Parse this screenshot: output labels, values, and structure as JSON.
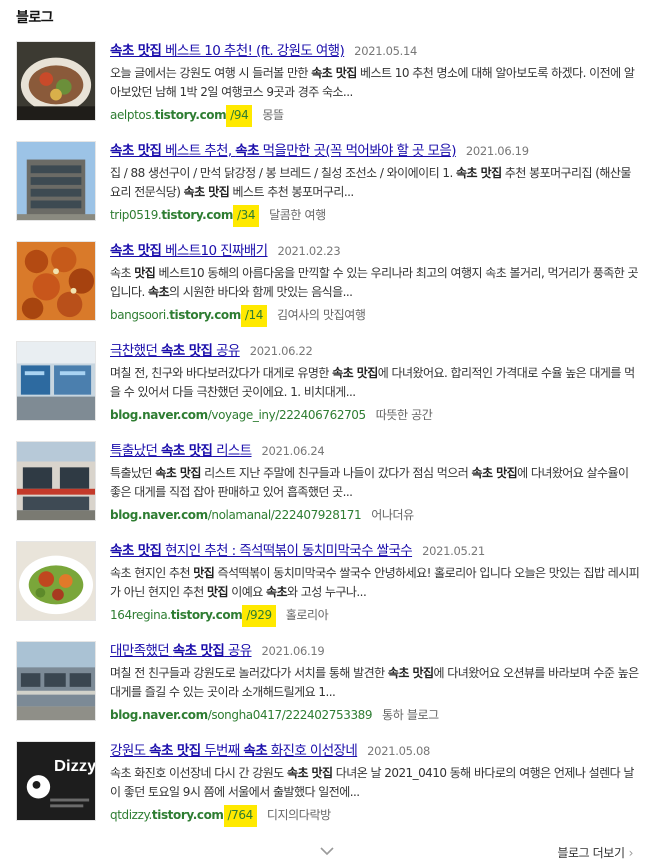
{
  "section": {
    "title": "블로그"
  },
  "results": [
    {
      "title_parts": [
        [
          "b",
          "속초 맛집"
        ],
        [
          "t",
          " 베스트 10 추천! (ft. 강원도 여행)"
        ]
      ],
      "date": "2021.05.14",
      "snippet_parts": [
        [
          "t",
          "오늘 글에서는 강원도 여행 시 들러볼 만한 "
        ],
        [
          "b",
          "속초 맛집"
        ],
        [
          "t",
          " 베스트 10 추천 명소에 대해 알아보도록 하겠다. 이전에 알아보았던 남해 1박 2일 여행코스 9곳과 경주 숙소..."
        ]
      ],
      "url_parts": [
        [
          "t",
          "aelptos."
        ],
        [
          "b",
          "tistory.com"
        ],
        [
          "h",
          "/94"
        ]
      ],
      "author": "몽뜰",
      "thumb": "food-bowl"
    },
    {
      "title_parts": [
        [
          "b",
          "속초 맛집"
        ],
        [
          "t",
          " 베스트 추천, "
        ],
        [
          "b",
          "속초"
        ],
        [
          "t",
          " 먹을만한 곳(꼭 먹어봐야 할 곳 모음)"
        ]
      ],
      "date": "2021.06.19",
      "snippet_parts": [
        [
          "t",
          "집 / 88 생선구이 / 만석 닭강정 / 봉 브레드 / 칠성 조선소 / 와이에이티 1. "
        ],
        [
          "b",
          "속초 맛집"
        ],
        [
          "t",
          " 추천 봉포머구리집 (해산물 요리 전문식당) "
        ],
        [
          "b",
          "속초 맛집"
        ],
        [
          "t",
          " 베스트 추천 봉포머구리..."
        ]
      ],
      "url_parts": [
        [
          "t",
          "trip0519."
        ],
        [
          "b",
          "tistory.com"
        ],
        [
          "h",
          "/34"
        ]
      ],
      "author": "달콤한 여행",
      "thumb": "building"
    },
    {
      "title_parts": [
        [
          "b",
          "속초 맛집"
        ],
        [
          "t",
          " 베스트10 진짜배기"
        ]
      ],
      "date": "2021.02.23",
      "snippet_parts": [
        [
          "t",
          "속초 "
        ],
        [
          "b",
          "맛집"
        ],
        [
          "t",
          " 베스트10 동해의 아름다움을 만끽할 수 있는 우리나라 최고의 여행지 속초 볼거리, 먹거리가 풍족한 곳입니다. "
        ],
        [
          "b",
          "속초"
        ],
        [
          "t",
          "의 시원한 바다와 함께 맛있는 음식을..."
        ]
      ],
      "url_parts": [
        [
          "t",
          "bangsoori."
        ],
        [
          "b",
          "tistory.com"
        ],
        [
          "h",
          "/14"
        ]
      ],
      "author": "김여사의 맛집여행",
      "thumb": "fried-chicken"
    },
    {
      "title_parts": [
        [
          "t",
          "극찬했던 "
        ],
        [
          "b",
          "속초 맛집"
        ],
        [
          "t",
          " 공유"
        ]
      ],
      "date": "2021.06.22",
      "snippet_parts": [
        [
          "t",
          "며칠 전, 친구와 바다보러갔다가 대게로 유명한 "
        ],
        [
          "b",
          "속초 맛집"
        ],
        [
          "t",
          "에 다녀왔어요. 합리적인 가격대로 수율 높은 대게를 먹을 수 있어서 다들 극찬했던 곳이에요. 1. 비치대게..."
        ]
      ],
      "url_parts": [
        [
          "b",
          "blog.naver.com"
        ],
        [
          "t",
          "/voyage_iny/222406762705"
        ]
      ],
      "author": "따뜻한 공간",
      "thumb": "market"
    },
    {
      "title_parts": [
        [
          "t",
          "특출났던 "
        ],
        [
          "b",
          "속초 맛집"
        ],
        [
          "t",
          " 리스트"
        ]
      ],
      "date": "2021.06.24",
      "snippet_parts": [
        [
          "t",
          "특출났던 "
        ],
        [
          "b",
          "속초 맛집"
        ],
        [
          "t",
          " 리스트  지난 주말에 친구들과 나들이 갔다가 점심 먹으러 "
        ],
        [
          "b",
          "속초 맛집"
        ],
        [
          "t",
          "에 다녀왔어요 살수율이 좋은 대게를 직접 잡아 판매하고 있어 흡족했던 곳..."
        ]
      ],
      "url_parts": [
        [
          "b",
          "blog.naver.com"
        ],
        [
          "t",
          "/nolamanal/222407928171"
        ]
      ],
      "author": "어나더유",
      "thumb": "store-front"
    },
    {
      "title_parts": [
        [
          "b",
          "속초 맛집"
        ],
        [
          "t",
          " 현지인 추천 : 즉석떡볶이 동치미막국수 쌀국수"
        ]
      ],
      "date": "2021.05.21",
      "snippet_parts": [
        [
          "t",
          "속초 현지인 추천 "
        ],
        [
          "b",
          "맛집"
        ],
        [
          "t",
          " 즉석떡볶이 동치미막국수 쌀국수 안녕하세요! 홀로리아 입니다 오늘은 맛있는 집밥 레시피가 아닌 현지인 추천 "
        ],
        [
          "b",
          "맛집"
        ],
        [
          "t",
          " 이예요 "
        ],
        [
          "b",
          "속초"
        ],
        [
          "t",
          "와 고성 누구나..."
        ]
      ],
      "url_parts": [
        [
          "t",
          "164regina."
        ],
        [
          "b",
          "tistory.com"
        ],
        [
          "h",
          "/929"
        ]
      ],
      "author": "홀로리아",
      "thumb": "salad"
    },
    {
      "title_parts": [
        [
          "t",
          "대만족했던 "
        ],
        [
          "b",
          "속초 맛집"
        ],
        [
          "t",
          " 공유"
        ]
      ],
      "date": "2021.06.19",
      "snippet_parts": [
        [
          "t",
          " 며칠 전 친구들과 강원도로 놀러갔다가 서치를 통해 발견한 "
        ],
        [
          "b",
          "속초 맛집"
        ],
        [
          "t",
          "에 다녀왔어요 오션뷰를 바라보며 수준 높은 대게를 즐길 수 있는 곳이라 소개해드릴게요    1..."
        ]
      ],
      "url_parts": [
        [
          "b",
          "blog.naver.com"
        ],
        [
          "t",
          "/songha0417/222402753389"
        ]
      ],
      "author": "통하 블로그",
      "thumb": "restaurant"
    },
    {
      "title_parts": [
        [
          "t",
          "강원도 "
        ],
        [
          "b",
          "속초 맛집"
        ],
        [
          "t",
          " 두번째 "
        ],
        [
          "b",
          "속초"
        ],
        [
          "t",
          " 화진호 이선장네"
        ]
      ],
      "date": "2021.05.08",
      "snippet_parts": [
        [
          "t",
          "속초 화진호 이선장네 다시 간 강원도 "
        ],
        [
          "b",
          "속초 맛집"
        ],
        [
          "t",
          " 다녀온 날 2021_0410 동해 바다로의 여행은 언제나 설렌다 날이 좋던 토요일 9시 쯤에 서울에서 출발했다 일전에..."
        ]
      ],
      "url_parts": [
        [
          "t",
          "qtdizzy."
        ],
        [
          "b",
          "tistory.com"
        ],
        [
          "h",
          "/764"
        ]
      ],
      "author": "디지의다락방",
      "thumb": "dizzy-logo",
      "thumb_text": "Dizzy"
    }
  ],
  "footer": {
    "more_label": "블로그 더보기",
    "more_arrow": "›"
  },
  "icons": {
    "expand": "chevron-down-icon"
  }
}
